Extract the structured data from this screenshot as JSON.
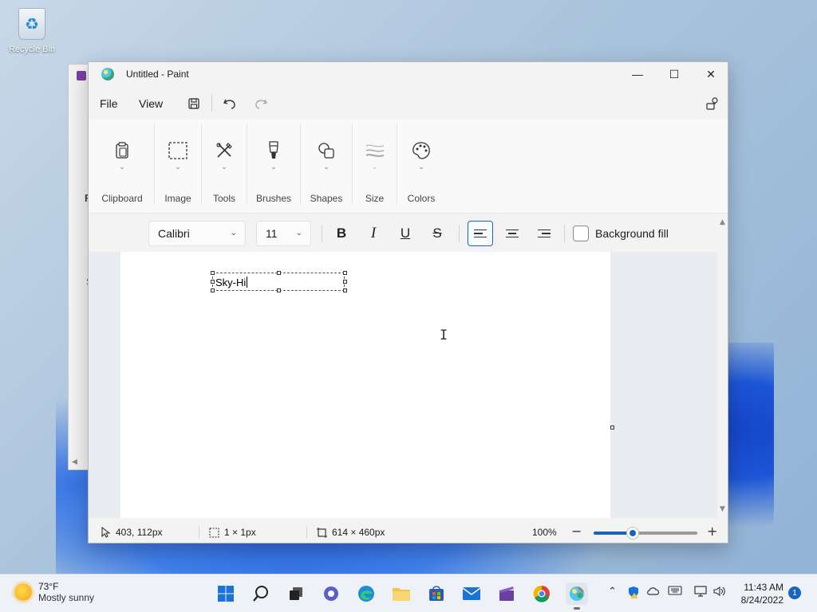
{
  "desktop": {
    "recycle_bin_label": "Recycle Bin"
  },
  "window": {
    "title": "Untitled - Paint",
    "controls": {
      "minimize": "—",
      "maximize": "☐",
      "close": "✕"
    }
  },
  "menubar": {
    "file": "File",
    "view": "View",
    "icons": {
      "save": "save-icon",
      "undo": "undo-icon",
      "redo": "redo-icon",
      "settings": "share-settings-icon"
    }
  },
  "ribbon": {
    "groups": [
      {
        "label": "Clipboard",
        "icon": "clipboard-icon"
      },
      {
        "label": "Image",
        "icon": "selection-icon"
      },
      {
        "label": "Tools",
        "icon": "tools-icon"
      },
      {
        "label": "Brushes",
        "icon": "brush-icon"
      },
      {
        "label": "Shapes",
        "icon": "shapes-icon"
      },
      {
        "label": "Size",
        "icon": "size-icon"
      },
      {
        "label": "Colors",
        "icon": "palette-icon"
      }
    ]
  },
  "text_toolbar": {
    "font": "Calibri",
    "size": "11",
    "bold": "B",
    "italic": "I",
    "underline": "U",
    "strikethrough": "S",
    "alignment_active": "left",
    "background_fill_label": "Background fill",
    "background_fill_checked": false
  },
  "canvas": {
    "text_content": "Sky-Hi"
  },
  "statusbar": {
    "cursor_position": "403, 112px",
    "selection_size": "1 × 1px",
    "canvas_size": "614 × 460px",
    "zoom": "100%",
    "zoom_fraction": 0.38
  },
  "taskbar": {
    "weather_temp": "73°F",
    "weather_desc": "Mostly sunny",
    "time": "11:43 AM",
    "date": "8/24/2022",
    "notification_count": "1"
  },
  "colors": {
    "accent": "#1764c0",
    "window_bg": "#f3f3f3",
    "canvas_bg": "#ffffff"
  }
}
